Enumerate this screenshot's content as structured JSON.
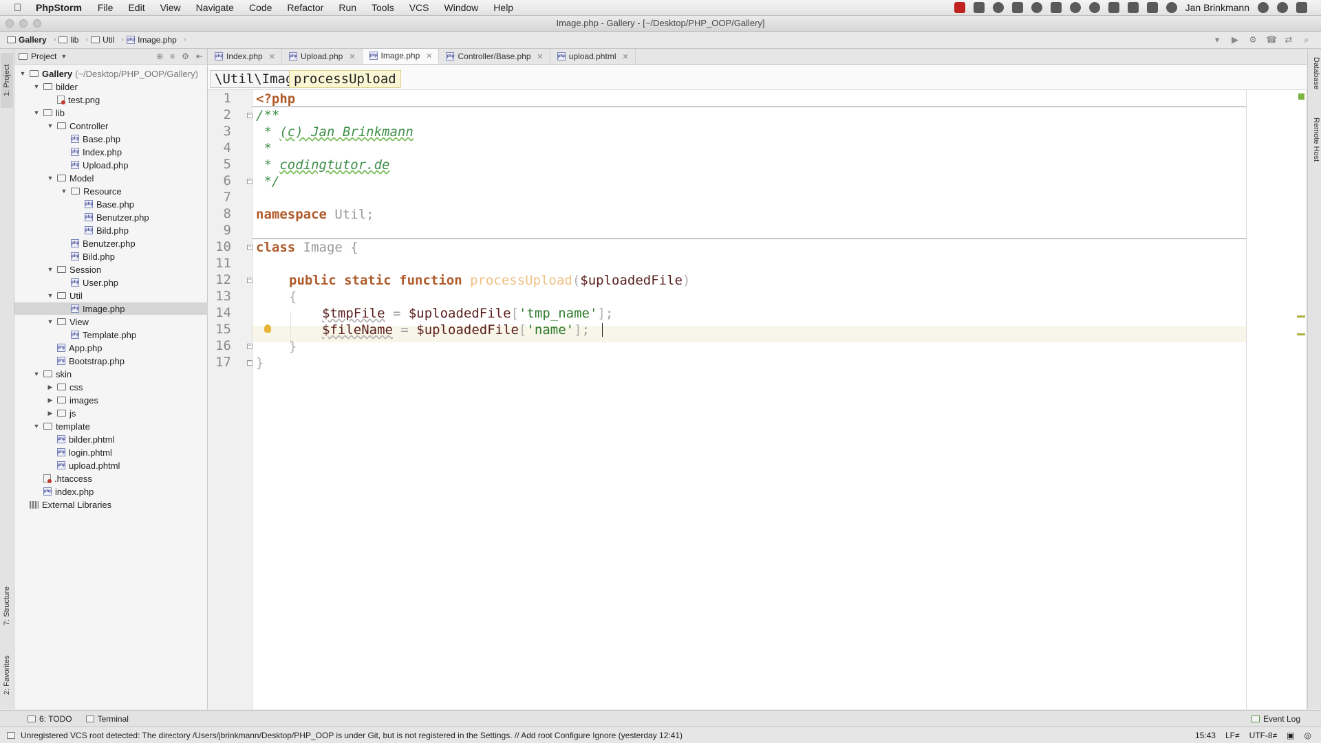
{
  "menubar": {
    "app_name": "PhpStorm",
    "items": [
      "File",
      "Edit",
      "View",
      "Navigate",
      "Code",
      "Refactor",
      "Run",
      "Tools",
      "VCS",
      "Window",
      "Help"
    ],
    "user": "Jan Brinkmann"
  },
  "window": {
    "title": "Image.php - Gallery - [~/Desktop/PHP_OOP/Gallery]"
  },
  "navbar": {
    "crumbs": [
      "Gallery",
      "lib",
      "Util",
      "Image.php"
    ]
  },
  "project_panel": {
    "title": "Project",
    "tree": [
      {
        "label": "Gallery",
        "path": "(~/Desktop/PHP_OOP/Gallery)",
        "type": "folder",
        "expanded": true
      },
      {
        "label": "bilder",
        "type": "folder",
        "expanded": true
      },
      {
        "label": "test.png",
        "type": "file"
      },
      {
        "label": "lib",
        "type": "folder",
        "expanded": true
      },
      {
        "label": "Controller",
        "type": "folder",
        "expanded": true
      },
      {
        "label": "Base.php",
        "type": "php"
      },
      {
        "label": "Index.php",
        "type": "php"
      },
      {
        "label": "Upload.php",
        "type": "php"
      },
      {
        "label": "Model",
        "type": "folder",
        "expanded": true
      },
      {
        "label": "Resource",
        "type": "folder",
        "expanded": true
      },
      {
        "label": "Base.php",
        "type": "php"
      },
      {
        "label": "Benutzer.php",
        "type": "php"
      },
      {
        "label": "Bild.php",
        "type": "php"
      },
      {
        "label": "Benutzer.php",
        "type": "php"
      },
      {
        "label": "Bild.php",
        "type": "php"
      },
      {
        "label": "Session",
        "type": "folder",
        "expanded": true
      },
      {
        "label": "User.php",
        "type": "php"
      },
      {
        "label": "Util",
        "type": "folder",
        "expanded": true
      },
      {
        "label": "Image.php",
        "type": "php",
        "selected": true
      },
      {
        "label": "View",
        "type": "folder",
        "expanded": true
      },
      {
        "label": "Template.php",
        "type": "php"
      },
      {
        "label": "App.php",
        "type": "php"
      },
      {
        "label": "Bootstrap.php",
        "type": "php"
      },
      {
        "label": "skin",
        "type": "folder",
        "expanded": true
      },
      {
        "label": "css",
        "type": "folder",
        "expanded": false
      },
      {
        "label": "images",
        "type": "folder",
        "expanded": false
      },
      {
        "label": "js",
        "type": "folder",
        "expanded": false
      },
      {
        "label": "template",
        "type": "folder",
        "expanded": true
      },
      {
        "label": "bilder.phtml",
        "type": "php"
      },
      {
        "label": "login.phtml",
        "type": "php"
      },
      {
        "label": "upload.phtml",
        "type": "php"
      },
      {
        "label": ".htaccess",
        "type": "htaccess"
      },
      {
        "label": "index.php",
        "type": "php"
      },
      {
        "label": "External Libraries",
        "type": "lib"
      }
    ]
  },
  "tabs": [
    {
      "label": "Index.php",
      "active": false
    },
    {
      "label": "Upload.php",
      "active": false
    },
    {
      "label": "Image.php",
      "active": true
    },
    {
      "label": "Controller/Base.php",
      "active": false
    },
    {
      "label": "upload.phtml",
      "active": false
    }
  ],
  "editor_breadcrumb": {
    "namespace": "\\Util\\Image",
    "method": "processUpload"
  },
  "editor": {
    "line_numbers": [
      "1",
      "2",
      "3",
      "4",
      "5",
      "6",
      "7",
      "8",
      "9",
      "10",
      "11",
      "12",
      "13",
      "14",
      "15",
      "16",
      "17"
    ],
    "code": {
      "l1": "<?php",
      "l2": "/**",
      "l3_star": " * ",
      "l3_text": "(c) Jan Brinkmann",
      "l4": " *",
      "l5_star": " * ",
      "l5_text": "codingtutor.de",
      "l6": " */",
      "l8_kw": "namespace",
      "l8_name": " Util",
      "l8_end": ";",
      "l10_kw": "class",
      "l10_name": " Image {",
      "l12_kw": "public static function",
      "l12_fn": " processUpload",
      "l12_open": "(",
      "l12_arg": "$uploadedFile",
      "l12_close": ")",
      "l13": "{",
      "l14_var": "$tmpFile",
      "l14_eq": " = ",
      "l14_src": "$uploadedFile",
      "l14_ob": "[",
      "l14_key": "'tmp_name'",
      "l14_cb": "]",
      "l14_end": ";",
      "l15_var": "$fileName",
      "l15_eq": " = ",
      "l15_src": "$uploadedFile",
      "l15_ob": "[",
      "l15_key": "'name'",
      "l15_cb": "]",
      "l15_end": ";",
      "l16": "}",
      "l17": "}"
    }
  },
  "left_strip": {
    "project_tab": "1: Project",
    "structure_tab": "7: Structure",
    "favorites_tab": "2: Favorites"
  },
  "right_strip": {
    "database_tab": "Database",
    "remote_host_tab": "Remote Host"
  },
  "tool_windows": {
    "todo": "6: TODO",
    "terminal": "Terminal",
    "event_log": "Event Log"
  },
  "status": {
    "message": "Unregistered VCS root detected: The directory /Users/jbrinkmann/Desktop/PHP_OOP is under Git, but is not registered in the Settings. // Add root  Configure  Ignore (yesterday 12:41)",
    "position": "15:43",
    "line_sep": "LF≠",
    "encoding": "UTF-8≠"
  }
}
